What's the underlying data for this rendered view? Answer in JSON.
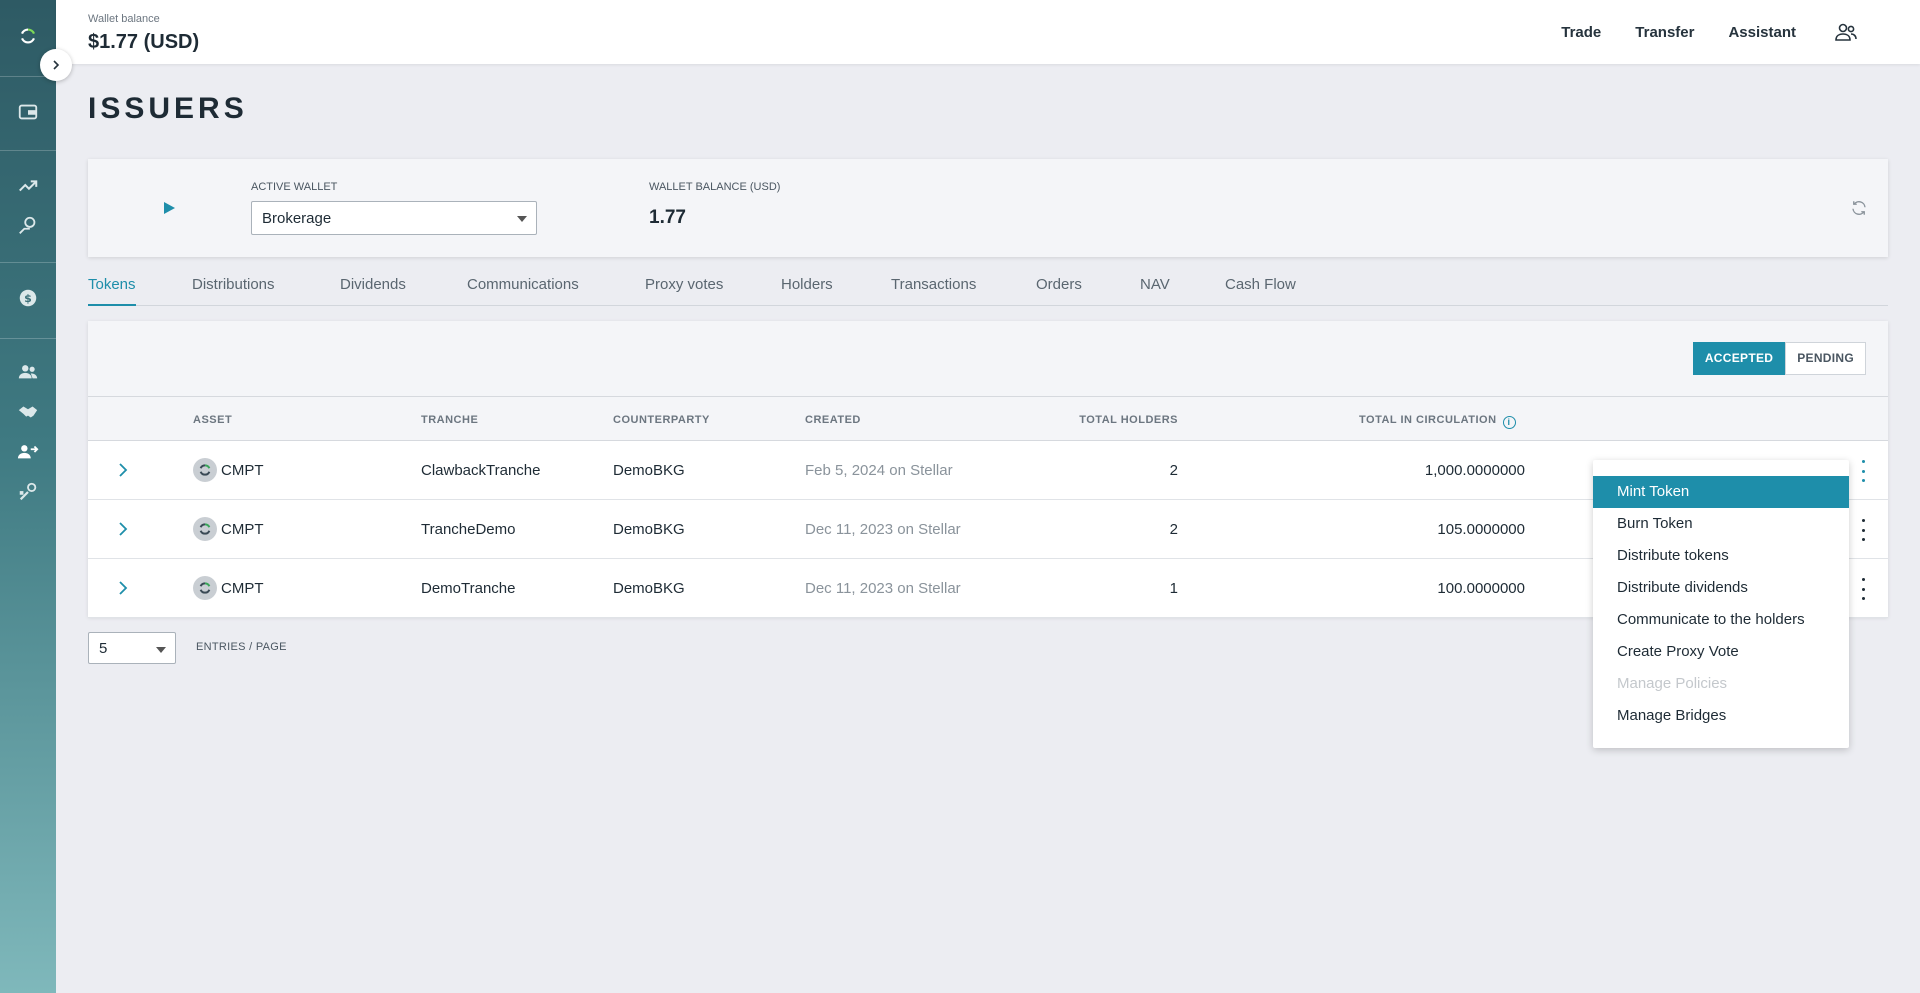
{
  "topbar": {
    "wallet_label": "Wallet balance",
    "wallet_value": "$1.77 (USD)",
    "nav": {
      "trade": "Trade",
      "transfer": "Transfer",
      "assistant": "Assistant"
    }
  },
  "page": {
    "title": "ISSUERS"
  },
  "wallet_card": {
    "active_wallet_label": "ACTIVE WALLET",
    "active_wallet_value": "Brokerage",
    "balance_label": "WALLET BALANCE (USD)",
    "balance_value": "1.77"
  },
  "tabs": [
    "Tokens",
    "Distributions",
    "Dividends",
    "Communications",
    "Proxy votes",
    "Holders",
    "Transactions",
    "Orders",
    "NAV",
    "Cash Flow"
  ],
  "filter": {
    "accepted": "ACCEPTED",
    "pending": "PENDING"
  },
  "table": {
    "headers": {
      "asset": "ASSET",
      "tranche": "TRANCHE",
      "counterparty": "COUNTERPARTY",
      "created": "CREATED",
      "total_holders": "TOTAL HOLDERS",
      "total_circulation": "TOTAL IN CIRCULATION"
    },
    "rows": [
      {
        "asset": "CMPT",
        "tranche": "ClawbackTranche",
        "counterparty": "DemoBKG",
        "created": "Feb 5, 2024 on Stellar",
        "holders": "2",
        "circulation": "1,000.0000000"
      },
      {
        "asset": "CMPT",
        "tranche": "TrancheDemo",
        "counterparty": "DemoBKG",
        "created": "Dec 11, 2023 on Stellar",
        "holders": "2",
        "circulation": "105.0000000"
      },
      {
        "asset": "CMPT",
        "tranche": "DemoTranche",
        "counterparty": "DemoBKG",
        "created": "Dec 11, 2023 on Stellar",
        "holders": "1",
        "circulation": "100.0000000"
      }
    ]
  },
  "pagination": {
    "page_size": "5",
    "entries_label": "ENTRIES / PAGE"
  },
  "menu": {
    "items": [
      "Mint Token",
      "Burn Token",
      "Distribute tokens",
      "Distribute dividends",
      "Communicate to the holders",
      "Create Proxy Vote",
      "Manage Policies",
      "Manage Bridges"
    ],
    "highlighted": "Mint Token",
    "disabled": "Manage Policies"
  },
  "colors": {
    "accent": "#1e8eaa",
    "sidebar_top": "#2e5a64",
    "sidebar_bottom": "#7fb8bb"
  }
}
